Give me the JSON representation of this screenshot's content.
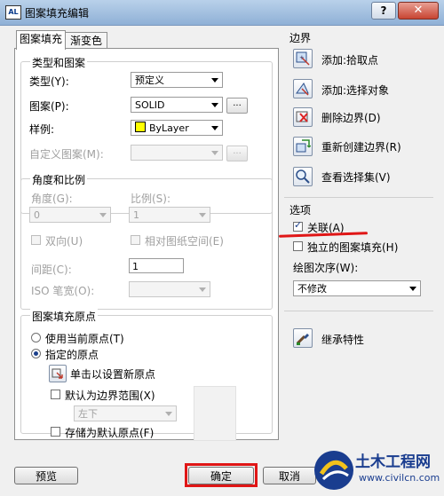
{
  "window": {
    "title": "图案填充编辑",
    "app_icon_text": "AL",
    "help": "?",
    "close": "✕"
  },
  "tabs": [
    {
      "label": "图案填充",
      "active": true
    },
    {
      "label": "渐变色",
      "active": false
    }
  ],
  "type_pattern": {
    "label": "类型和图案",
    "type_label": "类型(Y):",
    "type_value": "预定义",
    "pattern_label": "图案(P):",
    "pattern_value": "SOLID",
    "pattern_btn": "...",
    "sample_label": "样例:",
    "sample_value": "ByLayer",
    "custom_label": "自定义图案(M):",
    "custom_value": "",
    "custom_btn": "..."
  },
  "angle_scale": {
    "label": "角度和比例",
    "angle_label": "角度(G):",
    "angle_value": "0",
    "scale_label": "比例(S):",
    "scale_value": "1",
    "double_label": "双向(U)",
    "relative_label": "相对图纸空间(E)",
    "spacing_label": "间距(C):",
    "spacing_value": "1",
    "iso_label": "ISO 笔宽(O):",
    "iso_value": ""
  },
  "origin": {
    "label": "图案填充原点",
    "use_current": "使用当前原点(T)",
    "specified": "指定的原点",
    "click_set": "单击以设置新原点",
    "default_boundary": "默认为边界范围(X)",
    "position_value": "左下",
    "store_default": "存储为默认原点(F)"
  },
  "boundaries": {
    "label": "边界",
    "add_pick": "添加:拾取点",
    "add_select": "添加:选择对象",
    "remove": "删除边界(D)",
    "recreate": "重新创建边界(R)",
    "view": "查看选择集(V)"
  },
  "options": {
    "label": "选项",
    "associative": "关联(A)",
    "associative_checked": true,
    "separate": "独立的图案填充(H)",
    "separate_checked": false,
    "draw_order_label": "绘图次序(W):",
    "draw_order_value": "不修改"
  },
  "inherit": "继承特性",
  "buttons": {
    "preview": "预览",
    "ok": "确定",
    "cancel": "取消"
  },
  "watermark": {
    "text": "土木工程网",
    "url": "www.civilcn.com"
  },
  "colors": {
    "highlight": "#e01616",
    "accent": "#1b3f8b"
  }
}
